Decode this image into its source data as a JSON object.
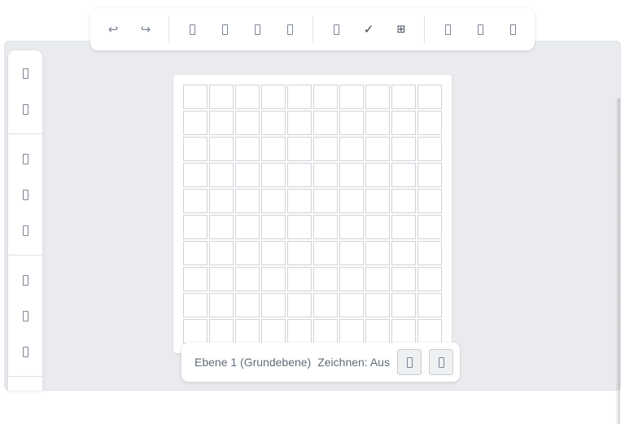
{
  "toolbar": {
    "undo_icon": "↩",
    "redo_icon": "↪",
    "check_icon": "✓",
    "grid_icon": "⊞"
  },
  "status": {
    "layer": "Ebene 1 (Grundebene)",
    "draw_mode": "Zeichnen: Aus"
  },
  "canvas": {
    "columns": 10,
    "rows": 10
  },
  "colors": {
    "background": "#e9ebee",
    "panel": "#ffffff",
    "cell_border": "#cfd3d8",
    "icon": "#7a8594"
  }
}
